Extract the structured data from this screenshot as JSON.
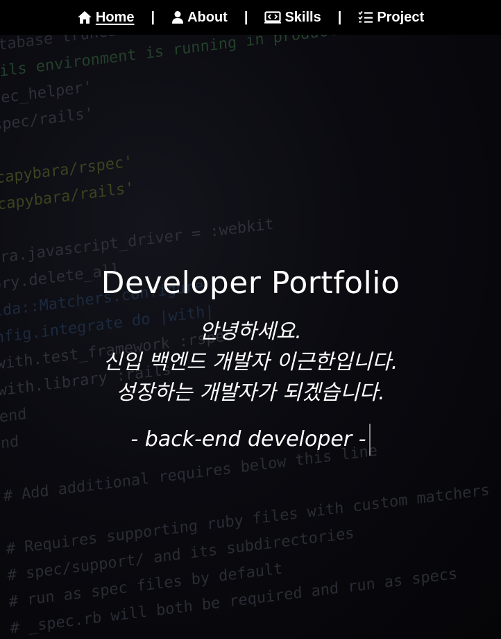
{
  "nav": {
    "items": [
      {
        "label": "Home",
        "icon": "home-icon",
        "active": true
      },
      {
        "label": "About",
        "icon": "user-icon",
        "active": false
      },
      {
        "label": "Skills",
        "icon": "code-icon",
        "active": false
      },
      {
        "label": "Project",
        "icon": "checklist-icon",
        "active": false
      }
    ],
    "separator": "|"
  },
  "hero": {
    "title": "Developer Portfolio",
    "greeting_lines": [
      "안녕하세요.",
      "신입 백엔드 개발자 이근한입니다.",
      "성장하는 개발자가 되겠습니다."
    ],
    "role": "- back-end developer -"
  },
  "background_code": [
    "database truncation of the environment",
    "Rails environment is running in production mode",
    "spec_helper'",
    "rspec/rails'",
    "",
    "'capybara/rspec'",
    "'capybara/rails'",
    "",
    "ara.javascript_driver = :webkit",
    "ory.delete_all",
    "ida::Matchers.configure",
    "nfig.integrate do |with|",
    "with.test_framework :rspec",
    "with.library :rails",
    "end",
    "nd",
    "",
    "# Add additional requires below this line",
    "",
    "# Requires supporting ruby files with custom matchers",
    "# spec/support/ and its subdirectories",
    "# run as spec files by default",
    "# _spec.rb will both be required and run as specs"
  ],
  "colors": {
    "nav_background": "#000000",
    "page_background": "#06060a",
    "text": "#ffffff"
  }
}
